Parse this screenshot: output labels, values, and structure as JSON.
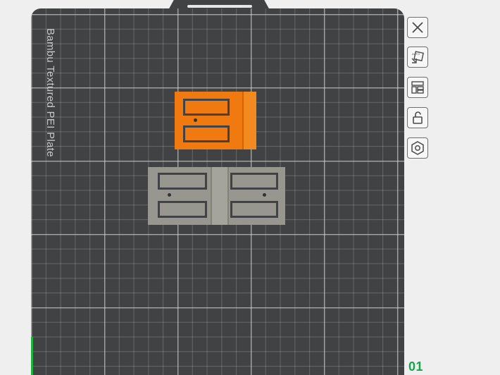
{
  "plate": {
    "label": "Bambu Textured PEI Plate",
    "index": "01",
    "colors": {
      "surface": "#414243",
      "grid": "#d7d7d7",
      "active_part": "#f07a10",
      "inactive_part": "#97978f",
      "axis": "#1fb33e"
    }
  },
  "toolbar": {
    "buttons": [
      {
        "name": "close",
        "icon": "close-icon"
      },
      {
        "name": "auto-orient",
        "icon": "auto-orient-icon"
      },
      {
        "name": "arrange",
        "icon": "arrange-icon"
      },
      {
        "name": "lock",
        "icon": "unlock-icon"
      },
      {
        "name": "plate-settings",
        "icon": "hexagon-settings-icon"
      }
    ]
  },
  "objects": [
    {
      "name": "part-1",
      "selected": true
    },
    {
      "name": "part-2",
      "selected": false
    },
    {
      "name": "part-3",
      "selected": false
    }
  ]
}
